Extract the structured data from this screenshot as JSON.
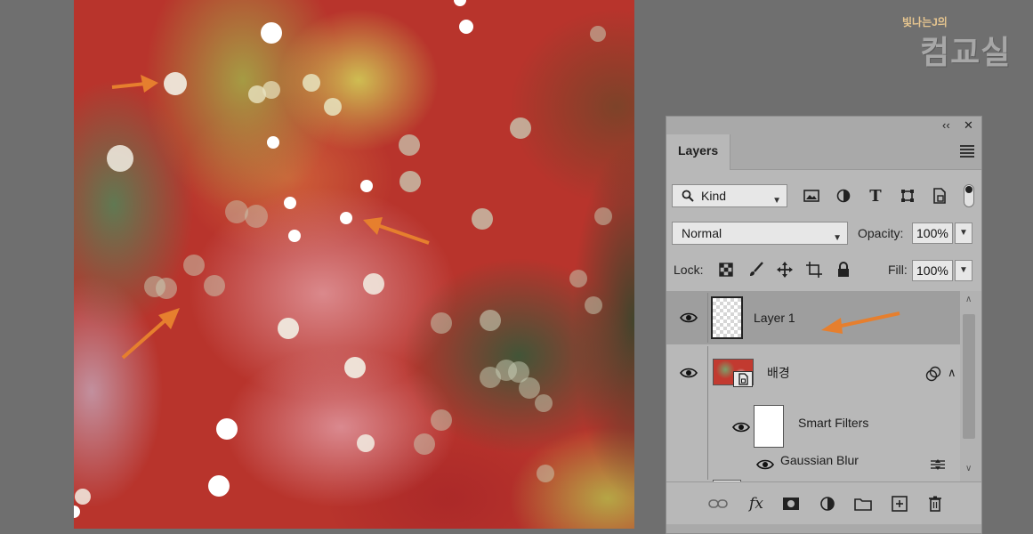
{
  "document": {
    "bokeh_colors": [
      "#ffffff",
      "#f2efe4",
      "#e8e4c0",
      "#c9cfb8"
    ],
    "arrow_color": "#e67f2e"
  },
  "watermark": {
    "small": "빛나는J의",
    "big": "컴교실"
  },
  "panel": {
    "topbar": {
      "collapse": "‹‹",
      "close": "✕"
    },
    "tab_title": "Layers",
    "filter": {
      "kind_label": "Kind",
      "icons": [
        "image-filter-icon",
        "adjustment-filter-icon",
        "type-filter-icon",
        "shape-filter-icon",
        "smart-object-filter-icon"
      ]
    },
    "blend": {
      "mode": "Normal",
      "opacity_label": "Opacity:",
      "opacity_value": "100%"
    },
    "lock": {
      "label": "Lock:",
      "fill_label": "Fill:",
      "fill_value": "100%"
    },
    "layers": [
      {
        "name": "Layer 1",
        "selected": true
      },
      {
        "name": "배경",
        "smart_object": true
      },
      {
        "name": "Smart Filters"
      },
      {
        "name": "Gaussian Blur"
      }
    ]
  }
}
